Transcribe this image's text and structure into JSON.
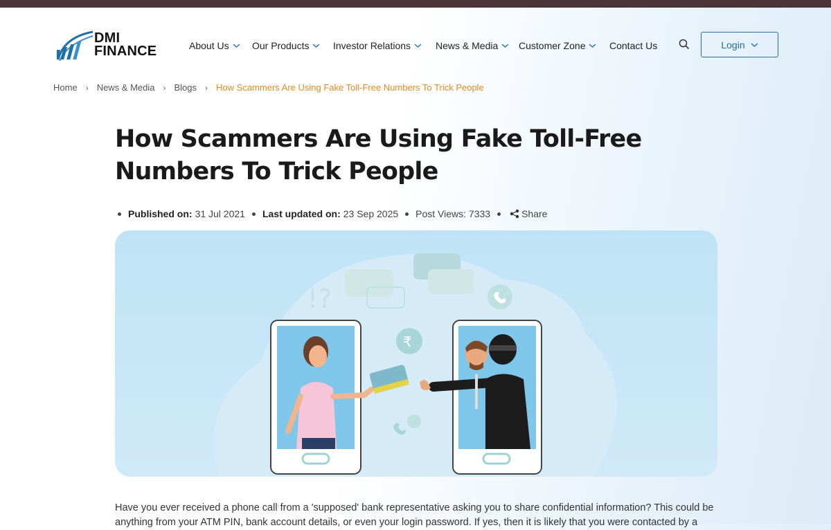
{
  "brand": {
    "line1": "DMI",
    "line2": "FINANCE"
  },
  "nav": {
    "items": [
      {
        "label": "About Us",
        "dropdown": true
      },
      {
        "label": "Our Products",
        "dropdown": true
      },
      {
        "label": "Investor Relations",
        "dropdown": true
      },
      {
        "label": "News & Media",
        "dropdown": true
      },
      {
        "label": "Customer Zone",
        "dropdown": true
      },
      {
        "label": "Contact Us",
        "dropdown": false
      }
    ],
    "search_icon": "search-icon",
    "login_label": "Login"
  },
  "breadcrumb": {
    "items": [
      "Home",
      "News & Media",
      "Blogs"
    ],
    "current": "How Scammers Are Using Fake Toll-Free Numbers To Trick People"
  },
  "article": {
    "title": "How Scammers Are Using Fake Toll-Free Numbers To Trick People",
    "published_label": "Published on:",
    "published_value": "31 Jul 2021",
    "updated_label": "Last updated on:",
    "updated_value": "23 Sep 2025",
    "views_text": "Post Views: 7333",
    "share_label": "Share",
    "intro": "Have you ever received a phone call from a 'supposed' bank representative asking you to share confidential information? This could be anything from your ATM PIN, bank account details, or even your login password. If yes, then it is likely that you were contacted by a"
  },
  "colors": {
    "accent": "#1f6fa8",
    "breadcrumb_current": "#e68a1e",
    "topbar": "#4a3438"
  }
}
